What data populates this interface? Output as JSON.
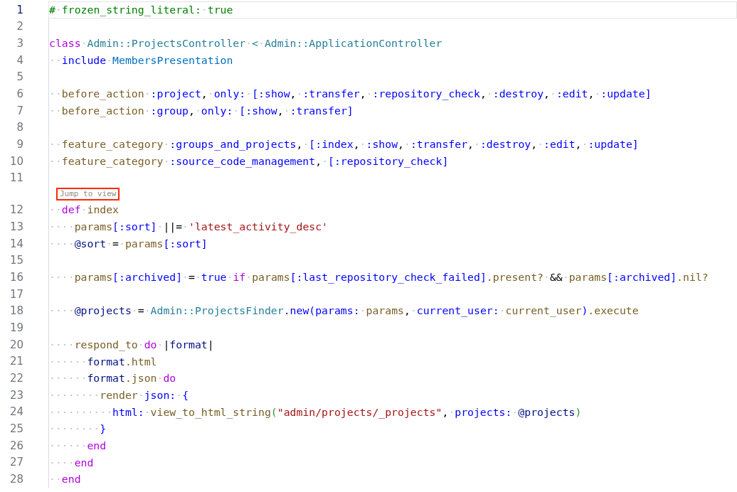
{
  "editor": {
    "rows": [
      {
        "kind": "code",
        "number": "1",
        "current": true,
        "tokens": [
          {
            "t": "#",
            "kind": "comment"
          },
          {
            "t": "·",
            "kind": "whitespace"
          },
          {
            "t": "frozen_string_literal:",
            "kind": "comment"
          },
          {
            "t": "·",
            "kind": "whitespace"
          },
          {
            "t": "true",
            "kind": "comment"
          }
        ]
      },
      {
        "kind": "code",
        "number": "2",
        "current": false
      },
      {
        "kind": "code",
        "number": "3",
        "current": false,
        "tokens": [
          {
            "t": "class",
            "kind": "keyword"
          },
          {
            "t": "·",
            "kind": "whitespace"
          },
          {
            "t": "Admin::ProjectsController",
            "kind": "constant"
          },
          {
            "t": "·",
            "kind": "whitespace"
          },
          {
            "t": "<",
            "kind": "constant"
          },
          {
            "t": "·",
            "kind": "whitespace"
          },
          {
            "t": "Admin::ApplicationController",
            "kind": "constant"
          }
        ]
      },
      {
        "kind": "code",
        "number": "4",
        "current": false,
        "tokens": [
          {
            "t": "··",
            "kind": "whitespace"
          },
          {
            "t": "include",
            "kind": "builtin"
          },
          {
            "t": "·",
            "kind": "whitespace"
          },
          {
            "t": "MembersPresentation",
            "kind": "module"
          }
        ]
      },
      {
        "kind": "code",
        "number": "5",
        "current": false
      },
      {
        "kind": "code",
        "number": "6",
        "current": false,
        "tokens": [
          {
            "t": "··",
            "kind": "whitespace"
          },
          {
            "t": "before_action",
            "kind": "method"
          },
          {
            "t": "·",
            "kind": "whitespace"
          },
          {
            "t": ":project",
            "kind": "symbol"
          },
          {
            "t": ",",
            "kind": "punct"
          },
          {
            "t": "·",
            "kind": "whitespace"
          },
          {
            "t": "only:",
            "kind": "symbol"
          },
          {
            "t": "·",
            "kind": "whitespace"
          },
          {
            "t": "[:show",
            "kind": "symbol"
          },
          {
            "t": ",",
            "kind": "punct"
          },
          {
            "t": "·",
            "kind": "whitespace"
          },
          {
            "t": ":transfer",
            "kind": "symbol"
          },
          {
            "t": ",",
            "kind": "punct"
          },
          {
            "t": "·",
            "kind": "whitespace"
          },
          {
            "t": ":repository_check",
            "kind": "symbol"
          },
          {
            "t": ",",
            "kind": "punct"
          },
          {
            "t": "·",
            "kind": "whitespace"
          },
          {
            "t": ":destroy",
            "kind": "symbol"
          },
          {
            "t": ",",
            "kind": "punct"
          },
          {
            "t": "·",
            "kind": "whitespace"
          },
          {
            "t": ":edit",
            "kind": "symbol"
          },
          {
            "t": ",",
            "kind": "punct"
          },
          {
            "t": "·",
            "kind": "whitespace"
          },
          {
            "t": ":update]",
            "kind": "symbol"
          }
        ]
      },
      {
        "kind": "code",
        "number": "7",
        "current": false,
        "tokens": [
          {
            "t": "··",
            "kind": "whitespace"
          },
          {
            "t": "before_action",
            "kind": "method"
          },
          {
            "t": "·",
            "kind": "whitespace"
          },
          {
            "t": ":group",
            "kind": "symbol"
          },
          {
            "t": ",",
            "kind": "punct"
          },
          {
            "t": "·",
            "kind": "whitespace"
          },
          {
            "t": "only:",
            "kind": "symbol"
          },
          {
            "t": "·",
            "kind": "whitespace"
          },
          {
            "t": "[:show",
            "kind": "symbol"
          },
          {
            "t": ",",
            "kind": "punct"
          },
          {
            "t": "·",
            "kind": "whitespace"
          },
          {
            "t": ":transfer]",
            "kind": "symbol"
          }
        ]
      },
      {
        "kind": "code",
        "number": "8",
        "current": false
      },
      {
        "kind": "code",
        "number": "9",
        "current": false,
        "tokens": [
          {
            "t": "··",
            "kind": "whitespace"
          },
          {
            "t": "feature_category",
            "kind": "method"
          },
          {
            "t": "·",
            "kind": "whitespace"
          },
          {
            "t": ":groups_and_projects",
            "kind": "symbol"
          },
          {
            "t": ",",
            "kind": "punct"
          },
          {
            "t": "·",
            "kind": "whitespace"
          },
          {
            "t": "[:index",
            "kind": "symbol"
          },
          {
            "t": ",",
            "kind": "punct"
          },
          {
            "t": "·",
            "kind": "whitespace"
          },
          {
            "t": ":show",
            "kind": "symbol"
          },
          {
            "t": ",",
            "kind": "punct"
          },
          {
            "t": "·",
            "kind": "whitespace"
          },
          {
            "t": ":transfer",
            "kind": "symbol"
          },
          {
            "t": ",",
            "kind": "punct"
          },
          {
            "t": "·",
            "kind": "whitespace"
          },
          {
            "t": ":destroy",
            "kind": "symbol"
          },
          {
            "t": ",",
            "kind": "punct"
          },
          {
            "t": "·",
            "kind": "whitespace"
          },
          {
            "t": ":edit",
            "kind": "symbol"
          },
          {
            "t": ",",
            "kind": "punct"
          },
          {
            "t": "·",
            "kind": "whitespace"
          },
          {
            "t": ":update]",
            "kind": "symbol"
          }
        ]
      },
      {
        "kind": "code",
        "number": "10",
        "current": false,
        "tokens": [
          {
            "t": "··",
            "kind": "whitespace"
          },
          {
            "t": "feature_category",
            "kind": "method"
          },
          {
            "t": "·",
            "kind": "whitespace"
          },
          {
            "t": ":source_code_management",
            "kind": "symbol"
          },
          {
            "t": ",",
            "kind": "punct"
          },
          {
            "t": "·",
            "kind": "whitespace"
          },
          {
            "t": "[:repository_check]",
            "kind": "symbol"
          }
        ]
      },
      {
        "kind": "code",
        "number": "11",
        "current": false
      },
      {
        "kind": "lens",
        "text": "Jump to view"
      },
      {
        "kind": "code",
        "number": "12",
        "current": false,
        "tokens": [
          {
            "t": "··",
            "kind": "whitespace"
          },
          {
            "t": "def",
            "kind": "keyword"
          },
          {
            "t": "·",
            "kind": "whitespace"
          },
          {
            "t": "index",
            "kind": "method"
          }
        ]
      },
      {
        "kind": "code",
        "number": "13",
        "current": false,
        "tokens": [
          {
            "t": "····",
            "kind": "whitespace"
          },
          {
            "t": "params",
            "kind": "method"
          },
          {
            "t": "[:sort]",
            "kind": "symbol"
          },
          {
            "t": "·",
            "kind": "whitespace"
          },
          {
            "t": "||=",
            "kind": "punct"
          },
          {
            "t": "·",
            "kind": "whitespace"
          },
          {
            "t": "'latest_activity_desc'",
            "kind": "string"
          }
        ]
      },
      {
        "kind": "code",
        "number": "14",
        "current": false,
        "tokens": [
          {
            "t": "····",
            "kind": "whitespace"
          },
          {
            "t": "@sort",
            "kind": "ivar"
          },
          {
            "t": "·",
            "kind": "whitespace"
          },
          {
            "t": "=",
            "kind": "punct"
          },
          {
            "t": "·",
            "kind": "whitespace"
          },
          {
            "t": "params",
            "kind": "method"
          },
          {
            "t": "[:sort]",
            "kind": "symbol"
          }
        ]
      },
      {
        "kind": "code",
        "number": "15",
        "current": false
      },
      {
        "kind": "code",
        "number": "16",
        "current": false,
        "tokens": [
          {
            "t": "····",
            "kind": "whitespace"
          },
          {
            "t": "params",
            "kind": "method"
          },
          {
            "t": "[:archived]",
            "kind": "symbol"
          },
          {
            "t": "·",
            "kind": "whitespace"
          },
          {
            "t": "=",
            "kind": "punct"
          },
          {
            "t": "·",
            "kind": "whitespace"
          },
          {
            "t": "true",
            "kind": "builtin"
          },
          {
            "t": "·",
            "kind": "whitespace"
          },
          {
            "t": "if",
            "kind": "keyword"
          },
          {
            "t": "·",
            "kind": "whitespace"
          },
          {
            "t": "params",
            "kind": "method"
          },
          {
            "t": "[:last_repository_check_failed]",
            "kind": "symbol"
          },
          {
            "t": ".present?",
            "kind": "method"
          },
          {
            "t": "·",
            "kind": "whitespace"
          },
          {
            "t": "&&",
            "kind": "punct"
          },
          {
            "t": "·",
            "kind": "whitespace"
          },
          {
            "t": "params",
            "kind": "method"
          },
          {
            "t": "[:archived]",
            "kind": "symbol"
          },
          {
            "t": ".nil?",
            "kind": "method"
          }
        ]
      },
      {
        "kind": "code",
        "number": "17",
        "current": false
      },
      {
        "kind": "code",
        "number": "18",
        "current": false,
        "tokens": [
          {
            "t": "····",
            "kind": "whitespace"
          },
          {
            "t": "@projects",
            "kind": "ivar"
          },
          {
            "t": "·",
            "kind": "whitespace"
          },
          {
            "t": "=",
            "kind": "punct"
          },
          {
            "t": "·",
            "kind": "whitespace"
          },
          {
            "t": "Admin::ProjectsFinder",
            "kind": "constant"
          },
          {
            "t": ".new(params:",
            "kind": "symbol"
          },
          {
            "t": "·",
            "kind": "whitespace"
          },
          {
            "t": "params",
            "kind": "method"
          },
          {
            "t": ",",
            "kind": "punct"
          },
          {
            "t": "·",
            "kind": "whitespace"
          },
          {
            "t": "current_user:",
            "kind": "symbol"
          },
          {
            "t": "·",
            "kind": "whitespace"
          },
          {
            "t": "current_user",
            "kind": "method"
          },
          {
            "t": ")",
            "kind": "symbol"
          },
          {
            "t": ".execute",
            "kind": "method"
          }
        ]
      },
      {
        "kind": "code",
        "number": "19",
        "current": false
      },
      {
        "kind": "code",
        "number": "20",
        "current": false,
        "tokens": [
          {
            "t": "····",
            "kind": "whitespace"
          },
          {
            "t": "respond_to",
            "kind": "method"
          },
          {
            "t": "·",
            "kind": "whitespace"
          },
          {
            "t": "do",
            "kind": "keyword"
          },
          {
            "t": "·",
            "kind": "whitespace"
          },
          {
            "t": "|",
            "kind": "punct"
          },
          {
            "t": "format",
            "kind": "ivar"
          },
          {
            "t": "|",
            "kind": "punct"
          }
        ]
      },
      {
        "kind": "code",
        "number": "21",
        "current": false,
        "tokens": [
          {
            "t": "······",
            "kind": "whitespace"
          },
          {
            "t": "format",
            "kind": "ivar"
          },
          {
            "t": ".html",
            "kind": "method"
          }
        ]
      },
      {
        "kind": "code",
        "number": "22",
        "current": false,
        "tokens": [
          {
            "t": "······",
            "kind": "whitespace"
          },
          {
            "t": "format",
            "kind": "ivar"
          },
          {
            "t": ".json",
            "kind": "method"
          },
          {
            "t": "·",
            "kind": "whitespace"
          },
          {
            "t": "do",
            "kind": "keyword"
          }
        ]
      },
      {
        "kind": "code",
        "number": "23",
        "current": false,
        "tokens": [
          {
            "t": "········",
            "kind": "whitespace"
          },
          {
            "t": "render",
            "kind": "method"
          },
          {
            "t": "·",
            "kind": "whitespace"
          },
          {
            "t": "json:",
            "kind": "symbol"
          },
          {
            "t": "·",
            "kind": "whitespace"
          },
          {
            "t": "{",
            "kind": "symbol"
          }
        ]
      },
      {
        "kind": "code",
        "number": "24",
        "current": false,
        "tokens": [
          {
            "t": "··········",
            "kind": "whitespace"
          },
          {
            "t": "html:",
            "kind": "symbol"
          },
          {
            "t": "·",
            "kind": "whitespace"
          },
          {
            "t": "view_to_html_string",
            "kind": "method"
          },
          {
            "t": "(",
            "kind": "paren"
          },
          {
            "t": "\"admin/projects/_projects\"",
            "kind": "string"
          },
          {
            "t": ",",
            "kind": "punct"
          },
          {
            "t": "·",
            "kind": "whitespace"
          },
          {
            "t": "projects:",
            "kind": "symbol"
          },
          {
            "t": "·",
            "kind": "whitespace"
          },
          {
            "t": "@projects",
            "kind": "ivar"
          },
          {
            "t": ")",
            "kind": "paren"
          }
        ]
      },
      {
        "kind": "code",
        "number": "25",
        "current": false,
        "tokens": [
          {
            "t": "········",
            "kind": "whitespace"
          },
          {
            "t": "}",
            "kind": "symbol"
          }
        ]
      },
      {
        "kind": "code",
        "number": "26",
        "current": false,
        "tokens": [
          {
            "t": "······",
            "kind": "whitespace"
          },
          {
            "t": "end",
            "kind": "keyword"
          }
        ]
      },
      {
        "kind": "code",
        "number": "27",
        "current": false,
        "tokens": [
          {
            "t": "····",
            "kind": "whitespace"
          },
          {
            "t": "end",
            "kind": "keyword"
          }
        ]
      },
      {
        "kind": "code",
        "number": "28",
        "current": false,
        "tokens": [
          {
            "t": "··",
            "kind": "whitespace"
          },
          {
            "t": "end",
            "kind": "keyword"
          }
        ]
      }
    ]
  }
}
